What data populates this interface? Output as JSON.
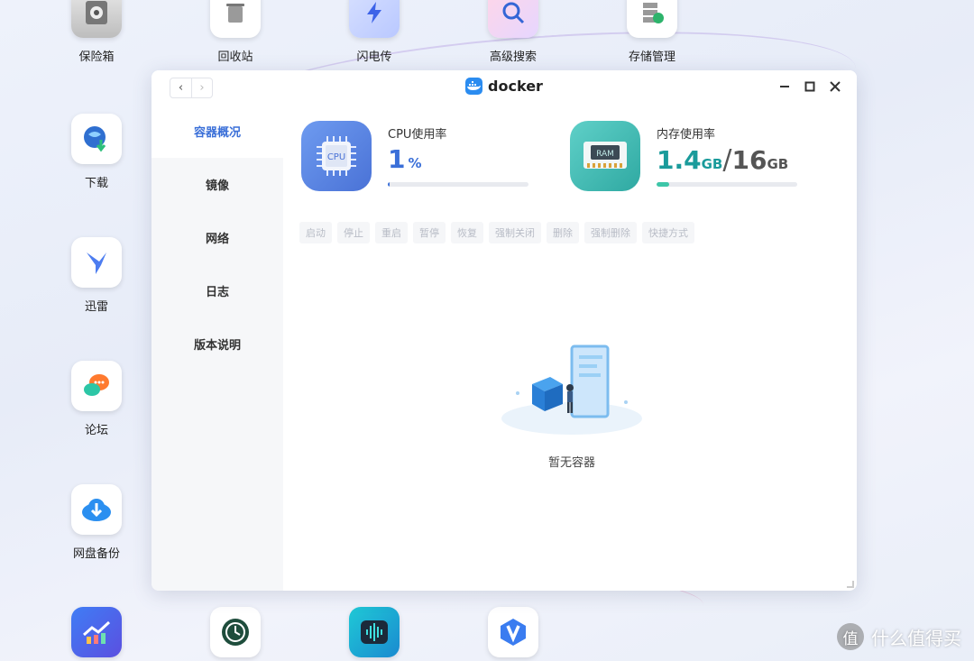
{
  "desktop": {
    "top_icons": [
      {
        "label": "保险箱",
        "icon": "safe-icon"
      },
      {
        "label": "回收站",
        "icon": "trash-icon"
      },
      {
        "label": "闪电传",
        "icon": "lightning-transfer-icon"
      },
      {
        "label": "高级搜索",
        "icon": "search-icon"
      },
      {
        "label": "存储管理",
        "icon": "storage-icon"
      }
    ],
    "left_icons": [
      {
        "label": "下载",
        "icon": "download-globe-icon"
      },
      {
        "label": "迅雷",
        "icon": "thunder-bird-icon"
      },
      {
        "label": "论坛",
        "icon": "forum-chat-icon"
      },
      {
        "label": "网盘备份",
        "icon": "cloud-backup-icon"
      }
    ],
    "bottom_icons": [
      {
        "icon": "chart-app-icon"
      },
      {
        "icon": "time-machine-icon"
      },
      {
        "icon": "audio-app-icon"
      },
      {
        "icon": "v-app-icon"
      }
    ]
  },
  "window": {
    "title": "docker",
    "nav_back": "‹",
    "nav_forward": "›",
    "sidebar": [
      {
        "label": "容器概况",
        "active": true
      },
      {
        "label": "镜像",
        "active": false
      },
      {
        "label": "网络",
        "active": false
      },
      {
        "label": "日志",
        "active": false
      },
      {
        "label": "版本说明",
        "active": false
      }
    ],
    "cpu": {
      "label": "CPU使用率",
      "value": "1",
      "unit": "%",
      "icon_text": "CPU",
      "percent": 1,
      "color": "#3a6fd8"
    },
    "memory": {
      "label": "内存使用率",
      "used": "1.4",
      "used_unit": "GB",
      "separator": "/",
      "total": "16",
      "total_unit": "GB",
      "icon_text": "RAM",
      "percent": 9,
      "color": "#1a9b9b"
    },
    "actions": [
      "启动",
      "停止",
      "重启",
      "暂停",
      "恢复",
      "强制关闭",
      "删除",
      "强制删除",
      "快捷方式"
    ],
    "empty_message": "暂无容器"
  },
  "watermark": {
    "symbol": "值",
    "text": "什么值得买"
  }
}
